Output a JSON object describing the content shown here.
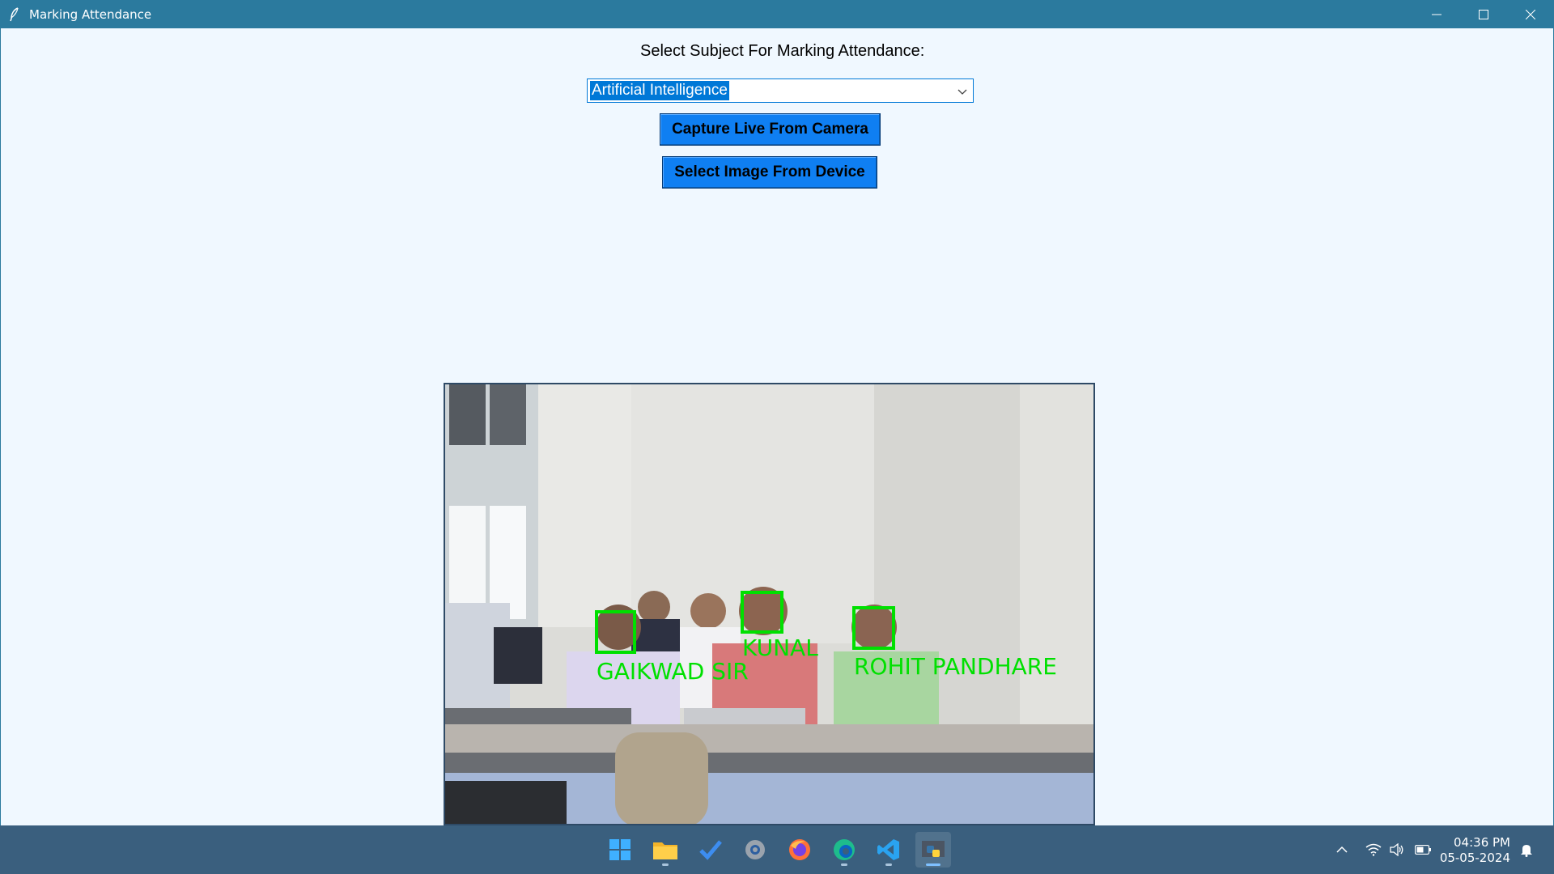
{
  "window": {
    "title": "Marking Attendance"
  },
  "form": {
    "subject_label": "Select Subject For Marking Attendance:",
    "subject_selected": "Artificial Intelligence",
    "capture_button": "Capture Live From Camera",
    "select_image_button": "Select Image From Device"
  },
  "photo": {
    "faces": [
      {
        "name": "GAIKWAD SIR"
      },
      {
        "name": "KUNAL"
      },
      {
        "name": "ROHIT PANDHARE"
      }
    ],
    "box_color": "#00e000"
  },
  "taskbar": {
    "apps": [
      {
        "name": "windows-start-icon"
      },
      {
        "name": "file-explorer-icon"
      },
      {
        "name": "todo-icon"
      },
      {
        "name": "settings-icon"
      },
      {
        "name": "firefox-icon"
      },
      {
        "name": "edge-icon"
      },
      {
        "name": "vscode-icon"
      },
      {
        "name": "python-icon"
      }
    ],
    "clock_time": "04:36 PM",
    "clock_date": "05-05-2024"
  },
  "colors": {
    "titlebar": "#2b7a9e",
    "background": "#f0f8ff",
    "button": "#0f7ff2",
    "selection": "#0078d7",
    "taskbar": "#3a5f7e"
  }
}
